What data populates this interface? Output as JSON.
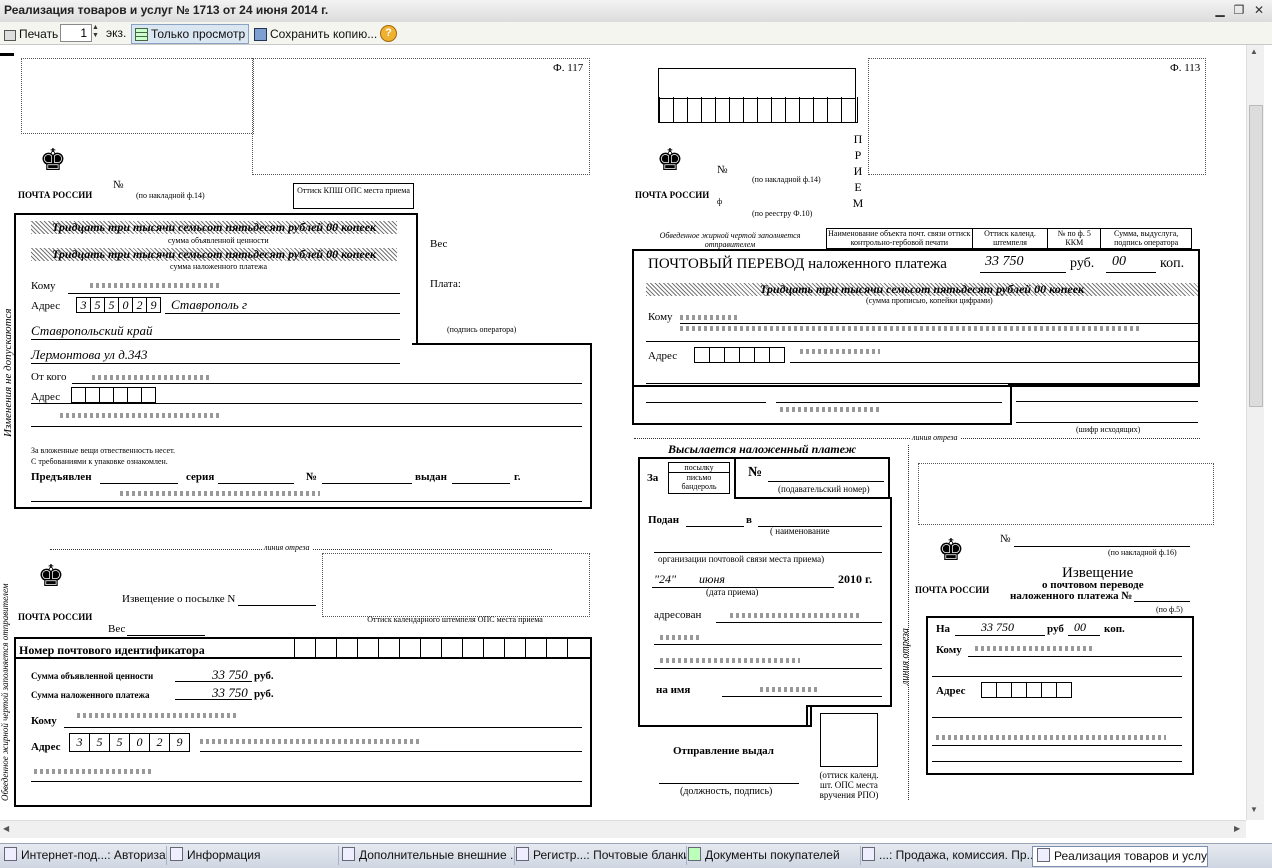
{
  "window": {
    "title": "Реализация товаров и услуг № 1713 от 24 июня 2014 г."
  },
  "toolbar": {
    "print_label": "Печать",
    "copies_value": "1",
    "copies_unit": "экз.",
    "view_only_label": "Только просмотр",
    "save_copy_label": "Сохранить копию..."
  },
  "form117": {
    "code": "Ф. 117",
    "logo": "ПОЧТА РОССИИ",
    "number_label": "№",
    "by_invoice": "(по накладной ф.14)",
    "stamp_label": "Оттиск КПШ ОПС места приема",
    "sum_declared": "Тридцать три тысячи семьсот пятьдесят рублей 00 копеек",
    "sum_declared_caption": "сумма объявленной ценности",
    "sum_cod": "Тридцать три тысячи семьсот пятьдесят рублей 00 копеек",
    "sum_cod_caption": "сумма наложенного платежа",
    "weight_label": "Вес",
    "fee_label": "Плата:",
    "operator_sign": "(подпись оператора)",
    "to_label": "Кому",
    "address_label": "Адрес",
    "index": [
      "3",
      "5",
      "5",
      "0",
      "2",
      "9"
    ],
    "city": "Ставрополь г",
    "region": "Ставропольский край",
    "street": "Лермонтова ул д.343",
    "from_label": "От кого",
    "from_address_label": "Адрес",
    "note1": "За вложенные вещи отвественность несет.",
    "note2": "С требованиями к упаковке ознакомлен.",
    "presented": "Предъявлен",
    "series": "серия",
    "num": "№",
    "issued": "выдан",
    "year": "г.",
    "side": "Изменения не допускаются"
  },
  "notice": {
    "cut_line": "линия отреза",
    "logo": "ПОЧТА РОССИИ",
    "title": "Извещение  о посылке N",
    "weight_label": "Вес",
    "stamp_label": "Оттиск календарного штемпеля ОПС места приема",
    "tracking_label": "Номер почтового идентификатора",
    "declared_label": "Сумма объявленной ценности",
    "declared_value": "33 750",
    "cod_label": "Сумма наложенного платежа",
    "cod_value": "33 750",
    "currency": "руб.",
    "to_label": "Кому",
    "address_label": "Адрес",
    "index": [
      "3",
      "5",
      "5",
      "0",
      "2",
      "9"
    ],
    "side": "Обведенное жирной чертой заполняется отправителем"
  },
  "form113": {
    "code": "Ф. 113",
    "priem": [
      "П",
      "Р",
      "И",
      "Е",
      "М"
    ],
    "logo": "ПОЧТА РОССИИ",
    "number_label": "№",
    "by_invoice": "(по накладной ф.14)",
    "fo": "ф",
    "by_register": "(по реестру Ф.10)",
    "fill_note": "Обведенное жирной чертой заполняется отправителем",
    "cols": [
      "Наименование объекта почт. связи оттиск контрольно-гербовой печати",
      "Оттиск календ. штемпеля",
      "№ по ф. 5 ККМ",
      "Сумма, выдуслуга, подпись оператора"
    ],
    "title": "ПОЧТОВЫЙ ПЕРЕВОД наложенного платежа",
    "amount_rub": "33 750",
    "rub_label": "руб.",
    "amount_kop": "00",
    "kop_label": "коп.",
    "sum_words": "Тридцать три тысячи семьсот пятьдесят рублей 00 копеек",
    "sum_caption": "(сумма прописью, копейки цифрами)",
    "to_label": "Кому",
    "address_label": "Адрес",
    "cipher": "(шифр исходящих)",
    "cut_line": "линия отреза"
  },
  "cod_block": {
    "title": "Высылается наложенный платеж",
    "za": "За",
    "types": [
      "посылку",
      "письмо",
      "бандероль"
    ],
    "num": "№",
    "tracking": "(подавательский номер)",
    "submitted": "Подан",
    "in": "в",
    "org_caption1": "( наименование",
    "org_caption2": "организации почтовой связи места приема)",
    "date_day": "\"24\"",
    "date_month": "июня",
    "date_year": "2010 г.",
    "date_caption": "(дата приема)",
    "addressed": "адресован",
    "name_label": "на имя",
    "issued_by": "Отправление выдал",
    "position_sign": "(должность, подпись)",
    "stamp_caption": "(оттиск календ. шт. ОПС места вручения РПО)"
  },
  "notice113": {
    "cut_line": "линия отреза",
    "logo": "ПОЧТА РОССИИ",
    "number_label": "№",
    "by_invoice": "(по накладной ф.16)",
    "title": "Извещение",
    "sub1": "о почтовом переводе",
    "sub2": "наложенного платежа №",
    "fo5": "(по ф.5)",
    "na": "На",
    "amount": "33 750",
    "rub": "руб",
    "kop": "00",
    "kop_label": "коп.",
    "to_label": "Кому",
    "address_label": "Адрес"
  },
  "taskbar": [
    {
      "label": "Интернет-под...: Авторизация"
    },
    {
      "label": "Информация"
    },
    {
      "label": "Дополнительные внешние ..."
    },
    {
      "label": "Регистр...: Почтовые бланки"
    },
    {
      "label": "Документы покупателей"
    },
    {
      "label": "...: Продажа, комиссия. Пр..."
    },
    {
      "label": "Реализация товаров и услу..."
    }
  ]
}
